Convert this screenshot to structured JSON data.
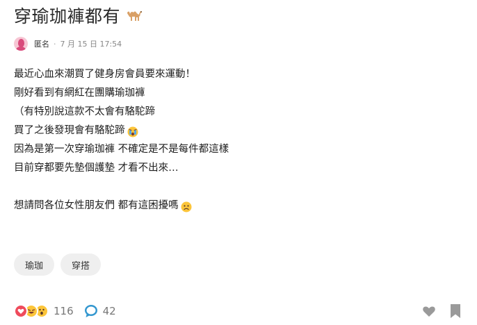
{
  "post": {
    "title": "穿瑜珈褲都有",
    "title_emoji_icon": "camel-icon",
    "author": "匿名",
    "separator": "·",
    "date": "7 月 15 日 17:54",
    "lines": [
      "最近心血來潮買了健身房會員要來運動！",
      "剛好看到有網紅在團購瑜珈褲",
      "（有特別說這款不太會有駱駝蹄",
      "買了之後發現會有駱駝蹄",
      "因為是第一次穿瑜珈褲 不確定是不是每件都這樣",
      "目前穿都要先墊個護墊 才看不出來…",
      "",
      "想請問各位女性朋友們 都有這困擾嗎"
    ]
  },
  "tags": [
    "瑜珈",
    "穿搭"
  ],
  "footer": {
    "reaction_count": "116",
    "comment_count": "42"
  },
  "colors": {
    "accent_blue": "#3397cf",
    "avatar_pink": "#d94a7b",
    "heart_red": "#ef4b5c",
    "emoji_yellow": "#fcc53a",
    "icon_gray": "#9a9a9a"
  }
}
